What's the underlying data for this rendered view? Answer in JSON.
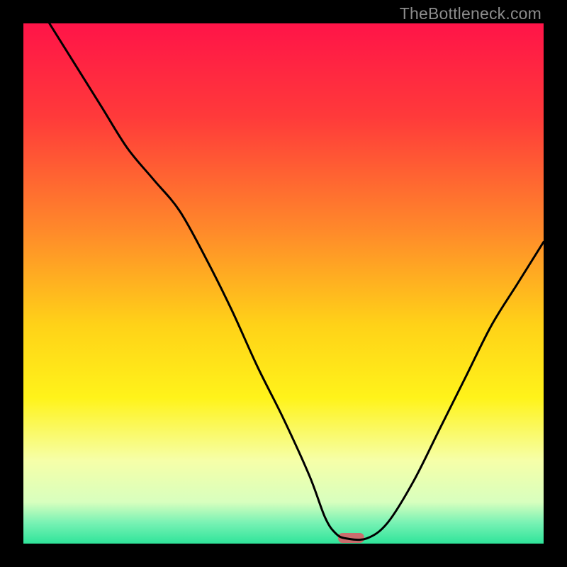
{
  "watermark": "TheBottleneck.com",
  "chart_data": {
    "type": "line",
    "title": "",
    "xlabel": "",
    "ylabel": "",
    "xlim": [
      0,
      100
    ],
    "ylim": [
      0,
      100
    ],
    "background_gradient_stops": [
      {
        "pct": 0,
        "color": "#ff1448"
      },
      {
        "pct": 18,
        "color": "#ff3a3a"
      },
      {
        "pct": 40,
        "color": "#ff8a2a"
      },
      {
        "pct": 58,
        "color": "#ffd218"
      },
      {
        "pct": 72,
        "color": "#fff31a"
      },
      {
        "pct": 84,
        "color": "#f6ffa8"
      },
      {
        "pct": 92,
        "color": "#d8ffbe"
      },
      {
        "pct": 96,
        "color": "#78f2b4"
      },
      {
        "pct": 100,
        "color": "#2fe49a"
      }
    ],
    "series": [
      {
        "name": "bottleneck-curve",
        "color": "#000000",
        "x": [
          5,
          10,
          15,
          20,
          25,
          30,
          35,
          40,
          45,
          50,
          55,
          58,
          60,
          62,
          66,
          70,
          75,
          80,
          85,
          90,
          95,
          100
        ],
        "y": [
          100,
          92,
          84,
          76,
          70,
          64,
          55,
          45,
          34,
          24,
          13,
          5,
          2,
          1,
          1,
          4,
          12,
          22,
          32,
          42,
          50,
          58
        ]
      }
    ],
    "marker": {
      "x_center": 63,
      "width": 5,
      "color": "#cb6d6d"
    }
  }
}
